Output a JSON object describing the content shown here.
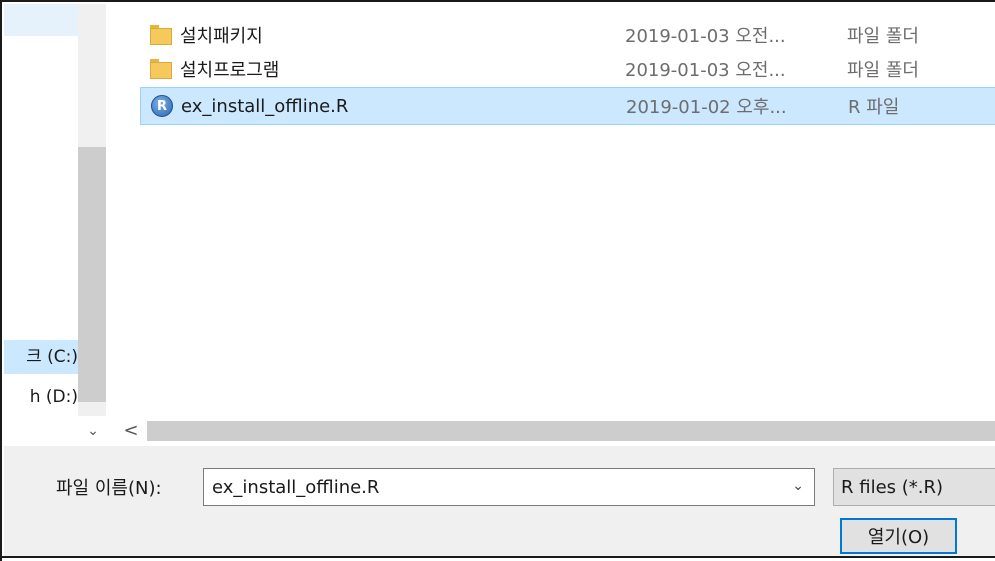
{
  "navigation": {
    "items": [
      {
        "label": "크 (C:)",
        "selected": true
      },
      {
        "label": "h (D:)",
        "selected": false
      }
    ]
  },
  "file_list": {
    "rows": [
      {
        "name": "설치패키지",
        "date": "2019-01-03 오전...",
        "type": "파일 폴더",
        "icon": "folder-icon",
        "selected": false
      },
      {
        "name": "설치프로그램",
        "date": "2019-01-03 오전...",
        "type": "파일 폴더",
        "icon": "folder-icon",
        "selected": false
      },
      {
        "name": "ex_install_offline.R",
        "date": "2019-01-02 오후...",
        "type": "R 파일",
        "icon": "r-file-icon",
        "selected": true
      }
    ]
  },
  "r_logo_letter": "R",
  "scrollbar": {
    "expand_glyph": "⌄",
    "left_arrow_glyph": "<"
  },
  "bottom": {
    "filename_label": "파일 이름(N):",
    "filename_value": "ex_install_offline.R",
    "filename_dropdown_glyph": "⌄",
    "filter_value": "R files (*.R)",
    "open_label": "열기(O)"
  },
  "colors": {
    "selection": "#cce8ff",
    "selection_border": "#99d1ff",
    "default_button_border": "#0078d7",
    "folder": "#f6c95c"
  }
}
